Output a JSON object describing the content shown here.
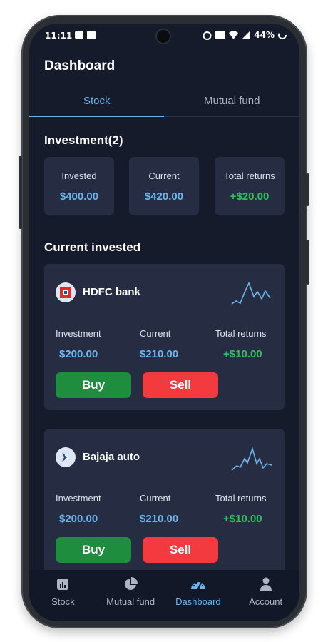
{
  "status_bar": {
    "time": "11:11",
    "battery": "44%"
  },
  "header": {
    "title": "Dashboard"
  },
  "tabs": [
    {
      "label": "Stock",
      "active": true
    },
    {
      "label": "Mutual fund",
      "active": false
    }
  ],
  "investment": {
    "title": "Investment(2)",
    "cards": [
      {
        "label": "Invested",
        "value": "$400.00"
      },
      {
        "label": "Current",
        "value": "$420.00"
      },
      {
        "label": "Total returns",
        "value": "+$20.00"
      }
    ]
  },
  "current_invested": {
    "title": "Current invested",
    "holdings": [
      {
        "name": "HDFC bank",
        "logo_icon": "hdfc-logo-icon",
        "investment_label": "Investment",
        "investment_value": "$200.00",
        "current_label": "Current",
        "current_value": "$210.00",
        "returns_label": "Total returns",
        "returns_value": "+$10.00",
        "buy_label": "Buy",
        "sell_label": "Sell"
      },
      {
        "name": "Bajaja auto",
        "logo_icon": "bajaj-logo-icon",
        "investment_label": "Investment",
        "investment_value": "$200.00",
        "current_label": "Current",
        "current_value": "$210.00",
        "returns_label": "Total returns",
        "returns_value": "+$10.00",
        "buy_label": "Buy",
        "sell_label": "Sell"
      }
    ]
  },
  "bottom_nav": [
    {
      "label": "Stock",
      "icon": "chart-icon",
      "active": false
    },
    {
      "label": "Mutual fund",
      "icon": "pie-chart-icon",
      "active": false
    },
    {
      "label": "Dashboard",
      "icon": "speedometer-icon",
      "active": true
    },
    {
      "label": "Account",
      "icon": "user-icon",
      "active": false
    }
  ],
  "colors": {
    "accent": "#6bb6ef",
    "positive": "#2ec15a",
    "buy": "#1e8e3e",
    "sell": "#f23a3f",
    "background": "#151b2b",
    "card": "#262d42"
  }
}
